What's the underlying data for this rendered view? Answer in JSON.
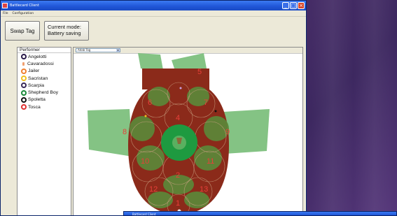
{
  "window": {
    "title": "Battlecard Client",
    "controls": {
      "minimize": "_",
      "maximize": "□",
      "close": "×"
    }
  },
  "menu": {
    "items": [
      "File",
      "Configuration"
    ]
  },
  "toolbar": {
    "swap_label": "Swap Tag",
    "mode_line1": "Current mode:",
    "mode_line2": "Battery saving"
  },
  "performers": {
    "header": "Performer",
    "items": [
      {
        "name": "Angelotti",
        "color": "#2a1a4a",
        "icon": "ring-icon"
      },
      {
        "name": "Cavaradossi",
        "color": "#f0a070",
        "icon": "small-tag-icon"
      },
      {
        "name": "Jailer",
        "color": "#f08030",
        "icon": "ring-icon"
      },
      {
        "name": "Sacristan",
        "color": "#f0c020",
        "icon": "ring-icon"
      },
      {
        "name": "Scarpia",
        "color": "#3a2a5a",
        "icon": "ring-icon"
      },
      {
        "name": "Shepherd Boy",
        "color": "#1a8a3a",
        "icon": "ring-icon"
      },
      {
        "name": "Spoletta",
        "color": "#111111",
        "icon": "ring-icon"
      },
      {
        "name": "Tosca",
        "color": "#e03030",
        "icon": "ring-icon"
      }
    ]
  },
  "map": {
    "selector_value": "Adab Tag",
    "zone_labels": [
      "1",
      "2",
      "4",
      "5",
      "6",
      "7",
      "8",
      "9",
      "10",
      "11",
      "12",
      "13"
    ],
    "colors": {
      "stage": "#8b2a1a",
      "zone": "#5a8a3a",
      "wing": "#6fb86f",
      "center": "#1e9a40",
      "label": "#e8403a"
    }
  },
  "second_window": {
    "title": "Battlecard Client"
  }
}
